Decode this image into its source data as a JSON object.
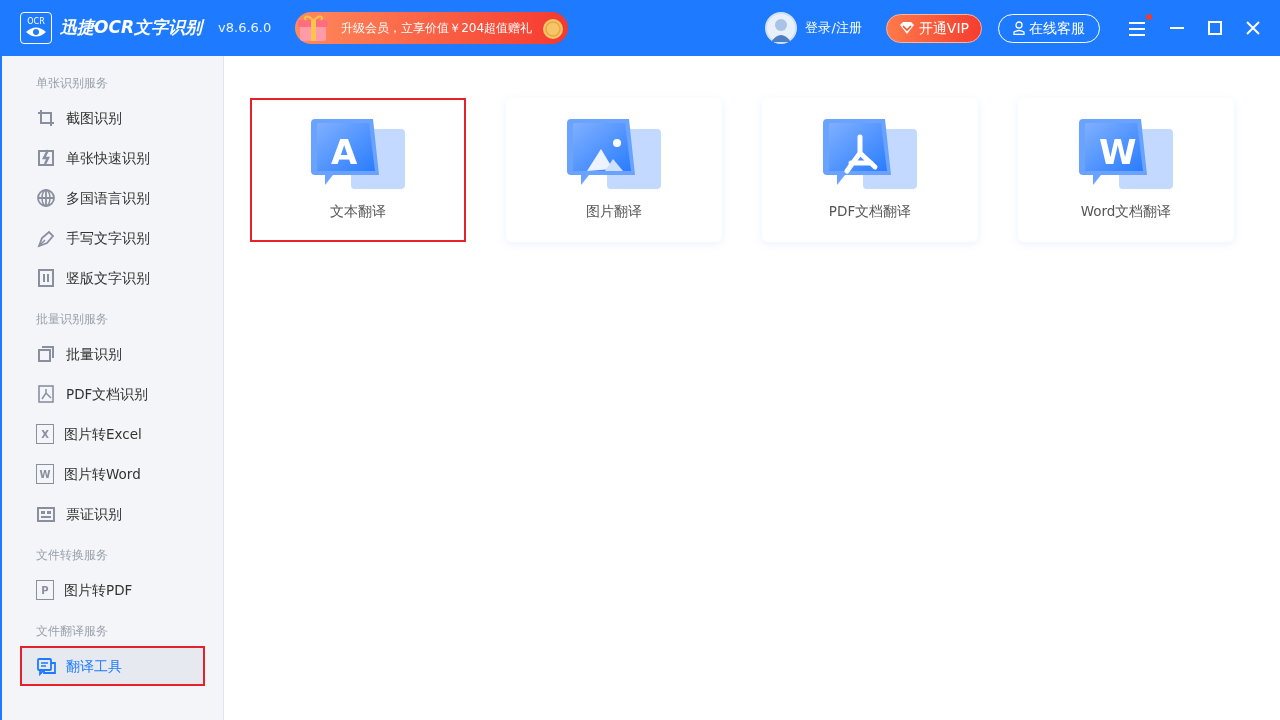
{
  "titlebar": {
    "logo_text": "OCR",
    "app_name": "迅捷OCR文字识别",
    "version": "v8.6.6.0",
    "promo": "升级会员，立享价值￥204超值赠礼",
    "login": "登录/注册",
    "vip_button": "开通VIP",
    "service_button": "在线客服",
    "menu_badge": true
  },
  "sidebar": {
    "sections": [
      {
        "title": "单张识别服务",
        "items": [
          {
            "label": "截图识别",
            "kind": "crop",
            "selected": false
          },
          {
            "label": "单张快速识别",
            "kind": "flash",
            "selected": false
          },
          {
            "label": "多国语言识别",
            "kind": "globe",
            "selected": false
          },
          {
            "label": "手写文字识别",
            "kind": "pen",
            "selected": false
          },
          {
            "label": "竖版文字识别",
            "kind": "vertical",
            "selected": false
          }
        ]
      },
      {
        "title": "批量识别服务",
        "items": [
          {
            "label": "批量识别",
            "kind": "stack",
            "selected": false
          },
          {
            "label": "PDF文档识别",
            "kind": "pdf",
            "selected": false
          },
          {
            "label": "图片转Excel",
            "kind": "letter",
            "letter": "X",
            "selected": false
          },
          {
            "label": "图片转Word",
            "kind": "letter",
            "letter": "W",
            "selected": false
          },
          {
            "label": "票证识别",
            "kind": "ticket",
            "selected": false
          }
        ]
      },
      {
        "title": "文件转换服务",
        "items": [
          {
            "label": "图片转PDF",
            "kind": "letter",
            "letter": "P",
            "selected": false
          }
        ]
      },
      {
        "title": "文件翻译服务",
        "items": [
          {
            "label": "翻译工具",
            "kind": "translate",
            "selected": true
          }
        ]
      }
    ]
  },
  "tools": [
    {
      "label": "文本翻译",
      "kind": "text",
      "glyph": "A",
      "selected": true
    },
    {
      "label": "图片翻译",
      "kind": "image",
      "selected": false
    },
    {
      "label": "PDF文档翻译",
      "kind": "pdf",
      "selected": false
    },
    {
      "label": "Word文档翻译",
      "kind": "text",
      "glyph": "W",
      "selected": false
    }
  ]
}
